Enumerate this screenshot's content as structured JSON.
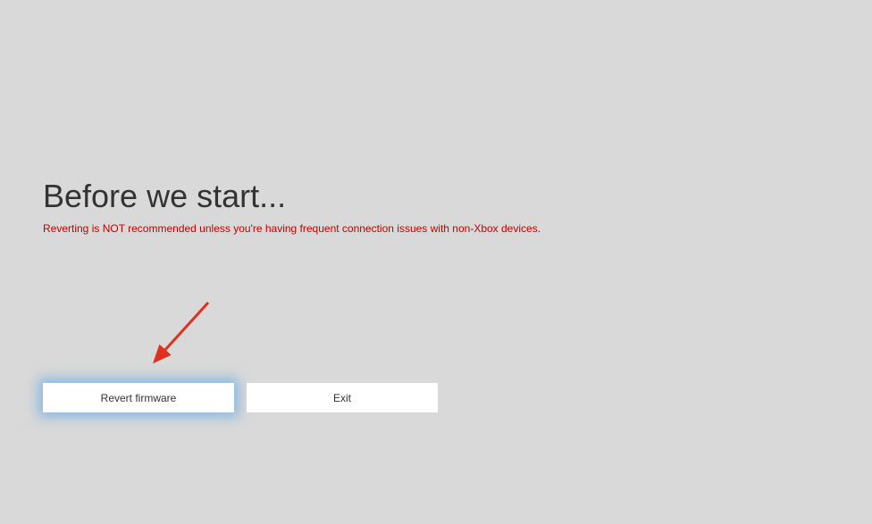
{
  "title": "Before we start...",
  "warning": "Reverting is NOT recommended unless you're having frequent connection issues with non-Xbox devices.",
  "buttons": {
    "revert": "Revert firmware",
    "exit": "Exit"
  }
}
